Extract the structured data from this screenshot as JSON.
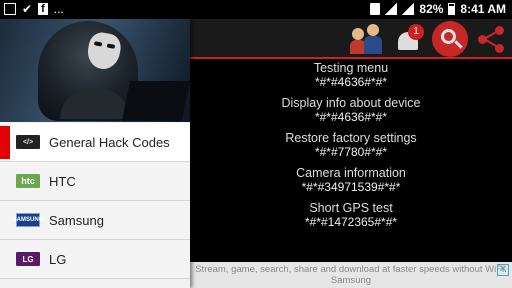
{
  "status_bar": {
    "left_icons": [
      "image-icon",
      "check-icon",
      "facebook-icon",
      "more-dots-icon"
    ],
    "more": "...",
    "facebook": "f",
    "battery": "82%",
    "time": "8:41 AM"
  },
  "toolbar": {
    "notification_count": "1"
  },
  "drawer": {
    "items": [
      {
        "label": "General Hack Codes",
        "logo": "</>",
        "active": true
      },
      {
        "label": "HTC",
        "logo": "htc"
      },
      {
        "label": "Samsung",
        "logo": "SAMSUNG"
      },
      {
        "label": "LG",
        "logo": "LG"
      }
    ]
  },
  "codes": [
    {
      "title": "Testing menu",
      "value": "*#*#4636#*#*"
    },
    {
      "title": "Display info about device",
      "value": "*#*#4636#*#*"
    },
    {
      "title": "Restore factory settings",
      "value": "*#*#7780#*#*"
    },
    {
      "title": "Camera information",
      "value": "*#*#34971539#*#*"
    },
    {
      "title": "Short GPS test",
      "value": "*#*#1472365#*#*"
    }
  ],
  "ad": {
    "text": "Stream, game, search, share and download at faster speeds without WiFi. Samsung"
  },
  "colors": {
    "accent": "#c62828",
    "active_indicator": "#e50000"
  }
}
